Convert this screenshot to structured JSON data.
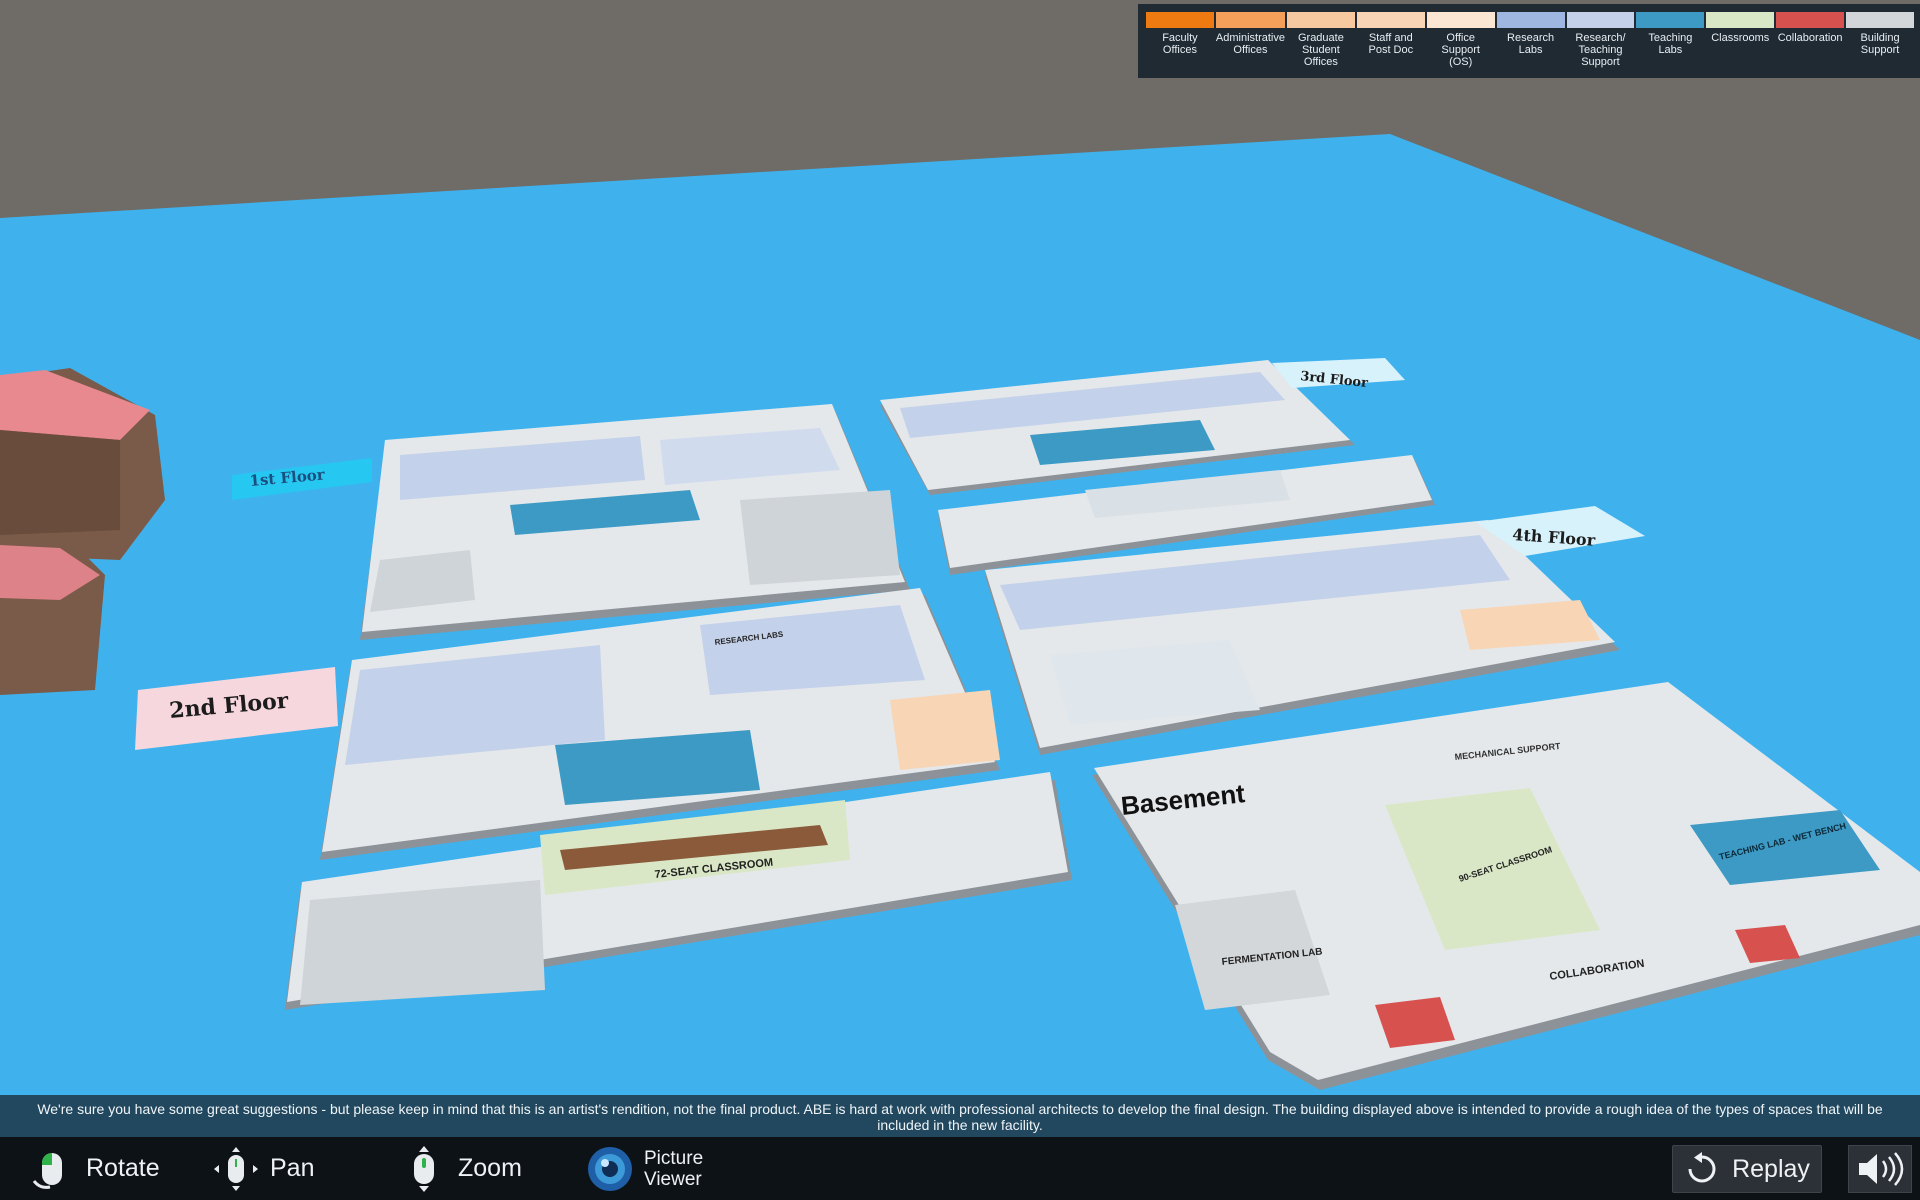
{
  "legend": {
    "items": [
      {
        "label": "Faculty\nOffices",
        "color": "#f07a12"
      },
      {
        "label": "Administrative\nOffices",
        "color": "#f4a05a"
      },
      {
        "label": "Graduate\nStudent\nOffices",
        "color": "#f6c9a0"
      },
      {
        "label": "Staff and\nPost Doc",
        "color": "#f8d5b5"
      },
      {
        "label": "Office\nSupport\n(OS)",
        "color": "#fbe6d4"
      },
      {
        "label": "Research\nLabs",
        "color": "#9fb6e0"
      },
      {
        "label": "Research/\nTeaching\nSupport",
        "color": "#c4d1ea"
      },
      {
        "label": "Teaching\nLabs",
        "color": "#3d9ac4"
      },
      {
        "label": "Classrooms",
        "color": "#d9e7c6"
      },
      {
        "label": "Collaboration",
        "color": "#d7524f"
      },
      {
        "label": "Building\nSupport",
        "color": "#d4d7da"
      }
    ]
  },
  "floors": {
    "first": "1st Floor",
    "second": "2nd Floor",
    "third": "3rd Floor",
    "fourth": "4th Floor",
    "basement": "Basement"
  },
  "rooms": {
    "classroom_72": "72-SEAT CLASSROOM",
    "classroom_90": "90-SEAT CLASSROOM",
    "fermentation_lab": "FERMENTATION LAB",
    "teaching_lab": "TEACHING LAB - WET BENCH",
    "collaboration": "COLLABORATION",
    "mechanical_support": "MECHANICAL SUPPORT",
    "research_labs": "RESEARCH LABS"
  },
  "disclaimer": "We're sure you have some great suggestions - but please keep in mind that this is an artist's rendition, not the final product.  ABE is hard at work with professional architects to develop the final design.  The building displayed above is intended to provide a rough idea of the types of spaces that will be included in the new facility.",
  "controls": {
    "rotate": "Rotate",
    "pan": "Pan",
    "zoom": "Zoom",
    "picture_viewer": "Picture Viewer",
    "replay": "Replay"
  },
  "icons": {
    "rotate": "mouse-left-click-icon",
    "pan": "mouse-move-icon",
    "zoom": "mouse-scroll-icon",
    "picture_viewer": "camera-lens-icon",
    "replay": "replay-icon",
    "volume": "speaker-icon"
  },
  "colors": {
    "ground": "#3fb2ee",
    "backdrop": "#6f6b66",
    "floor_plate": "#dfe3e6",
    "wall": "#9aa0a6"
  }
}
